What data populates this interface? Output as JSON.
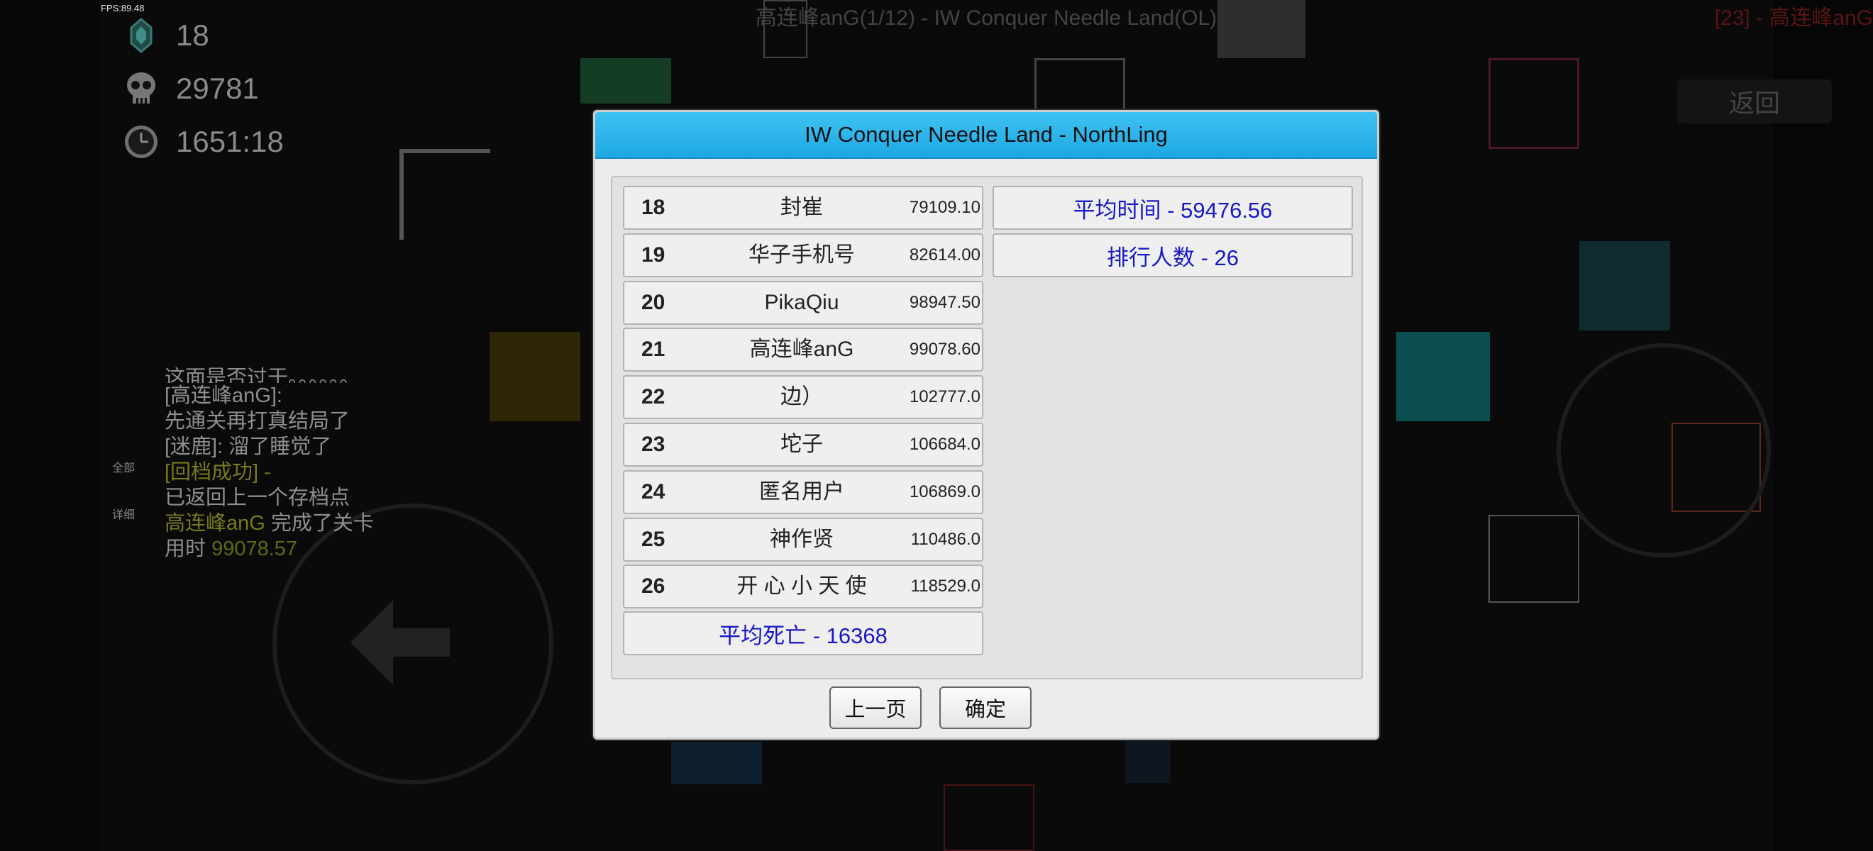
{
  "hud": {
    "fps": "FPS:89.48",
    "title": "高连峰anG(1/12) - IW Conquer Needle Land(OL)",
    "right_name": "[23] - 高连峰anG",
    "back_label": "返回",
    "gems": "18",
    "deaths": "29781",
    "time": "1651:18",
    "icons": [
      "gem-icon",
      "skull-icon",
      "clock-icon"
    ]
  },
  "chat": {
    "tab_all": "全部",
    "tab_detail": "详细",
    "lines": [
      "这面是否过于。。。。。。",
      "[高连峰anG]:",
      "先通关再打真结局了",
      "[迷鹿]: 溜了睡觉了",
      "[回档成功] -",
      "已返回上一个存档点",
      "高连峰anG",
      " 完成了关卡",
      "用时 ",
      "99078.57"
    ]
  },
  "dialog": {
    "title": "IW Conquer Needle Land - NorthLing",
    "rows": [
      {
        "rank": "18",
        "name": "封崔",
        "time": "79109.10"
      },
      {
        "rank": "19",
        "name": "华子手机号",
        "time": "82614.00"
      },
      {
        "rank": "20",
        "name": "PikaQiu",
        "time": "98947.50"
      },
      {
        "rank": "21",
        "name": "高连峰anG",
        "time": "99078.60"
      },
      {
        "rank": "22",
        "name": "边）",
        "time": "102777.0"
      },
      {
        "rank": "23",
        "name": "坨子",
        "time": "106684.0"
      },
      {
        "rank": "24",
        "name": "匿名用户",
        "time": "106869.0"
      },
      {
        "rank": "25",
        "name": "神作贤",
        "time": "110486.0"
      },
      {
        "rank": "26",
        "name": "开 心 小 天 使",
        "time": "118529.0"
      }
    ],
    "avg_deaths": "平均死亡 - 16368",
    "avg_time": "平均时间 - 59476.56",
    "player_count": "排行人数 - 26",
    "prev_label": "上一页",
    "ok_label": "确定"
  },
  "colors": {
    "title_bar": "#29b6ee",
    "stat_text": "#1818c8",
    "chat_highlight": "#777a1a"
  }
}
